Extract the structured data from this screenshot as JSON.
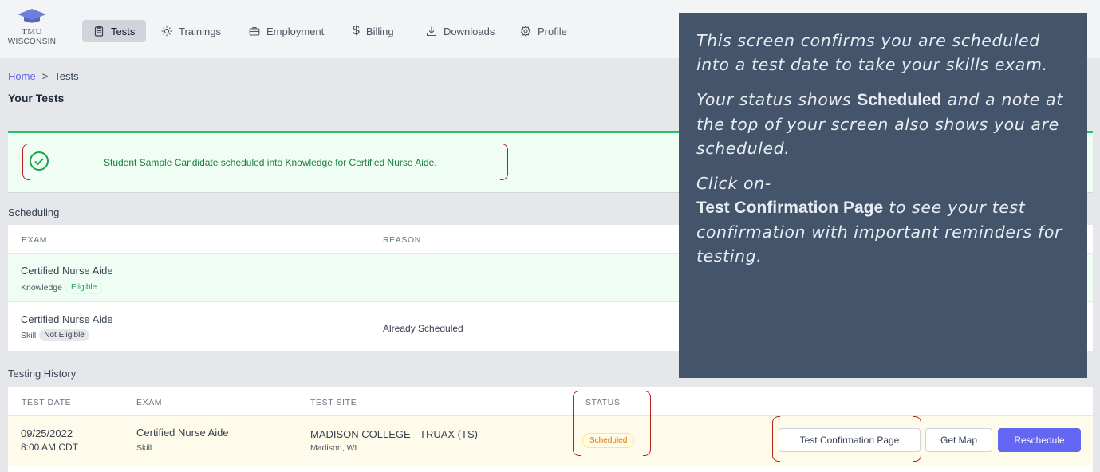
{
  "brand": {
    "line1": "TMU",
    "line2": "WISCONSIN"
  },
  "nav": [
    {
      "label": "Tests",
      "icon": "clipboard-icon",
      "active": true
    },
    {
      "label": "Trainings",
      "icon": "lightbulb-icon"
    },
    {
      "label": "Employment",
      "icon": "briefcase-icon"
    },
    {
      "label": "Billing",
      "icon": "dollar-icon"
    },
    {
      "label": "Downloads",
      "icon": "download-icon"
    },
    {
      "label": "Profile",
      "icon": "gear-icon"
    }
  ],
  "breadcrumb": {
    "home": "Home",
    "separator": ">",
    "current": "Tests"
  },
  "page_title": "Your Tests",
  "alert": {
    "message": "Student Sample Candidate scheduled into Knowledge for Certified Nurse Aide.",
    "icon": "check-circle-icon"
  },
  "scheduling": {
    "label": "Scheduling",
    "headers": {
      "exam": "EXAM",
      "reason": "REASON"
    },
    "rows": [
      {
        "exam": "Certified Nurse Aide",
        "type": "Knowledge",
        "badge": "Eligible",
        "reason": ""
      },
      {
        "exam": "Certified Nurse Aide",
        "type": "Skill",
        "badge": "Not Eligible",
        "reason": "Already Scheduled"
      }
    ]
  },
  "history": {
    "label": "Testing History",
    "headers": {
      "date": "TEST DATE",
      "exam": "EXAM",
      "site": "TEST SITE",
      "status": "STATUS"
    },
    "rows": [
      {
        "date": "09/25/2022",
        "time": "8:00 AM CDT",
        "exam": "Certified Nurse Aide",
        "type": "Skill",
        "site": "MADISON COLLEGE - TRUAX (TS)",
        "city": "Madison, WI",
        "status": "Scheduled",
        "buttons": {
          "confirm": "Test Confirmation Page",
          "map": "Get Map",
          "reschedule": "Reschedule"
        }
      }
    ]
  },
  "callout": {
    "p1": "This screen confirms you are scheduled into a test date to take your skills exam.",
    "p2a": "Your status shows ",
    "p2b": "Scheduled",
    "p2c": " and a note at the top of your screen also shows you are scheduled.",
    "p3a": "Click on-",
    "p3b": "Test Confirmation Page",
    "p3c": " to see your test confirmation with important reminders for testing."
  },
  "colors": {
    "accent": "#6366f1",
    "success": "#22c55e",
    "callout_bg": "#44546a",
    "annotation": "#b42318"
  }
}
